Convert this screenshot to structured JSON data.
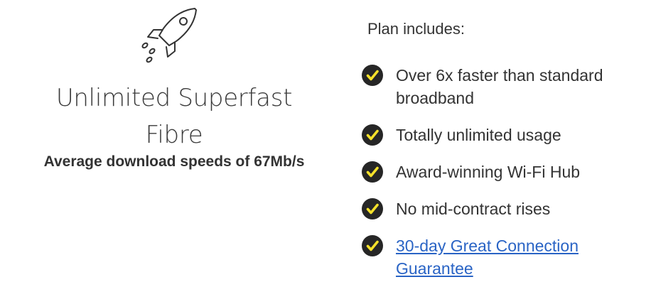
{
  "plan": {
    "icon": "rocket-icon",
    "title_line1": "Unlimited Superfast",
    "title_line2": "Fibre",
    "subtitle": "Average download speeds of 67Mb/s"
  },
  "includes": {
    "heading": "Plan includes:",
    "check_icon": "check-circle-icon",
    "check_color": "#f5e12a",
    "items": [
      {
        "label": "Over 6x faster than standard broadband",
        "is_link": false
      },
      {
        "label": "Totally unlimited usage",
        "is_link": false
      },
      {
        "label": "Award-winning Wi-Fi Hub",
        "is_link": false
      },
      {
        "label": "No mid-contract rises",
        "is_link": false
      },
      {
        "label": "30-day Great Connection Guarantee",
        "is_link": true
      }
    ]
  },
  "colors": {
    "text": "#333333",
    "link": "#2a64c5",
    "check_circle": "#262626",
    "check_mark": "#f5e12a"
  }
}
